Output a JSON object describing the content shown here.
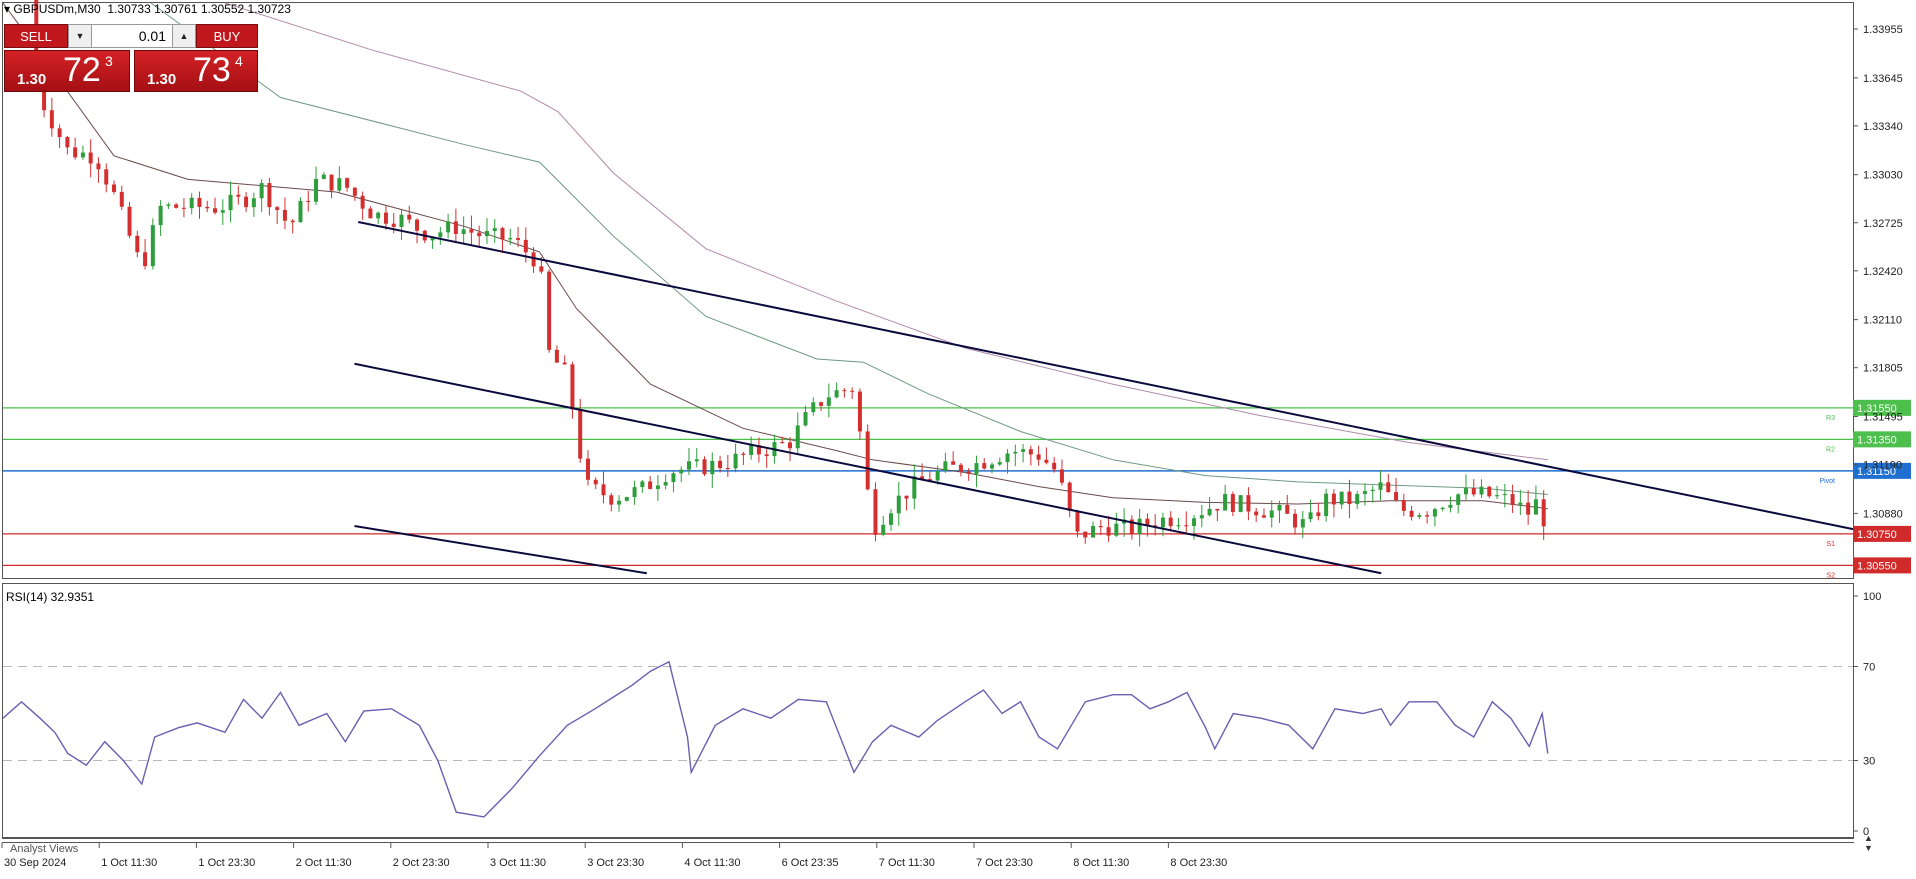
{
  "symbol_header": {
    "symbol": "GBPUSDm,M30",
    "ohlc": "1.30733 1.30761 1.30552 1.30723"
  },
  "trade_panel": {
    "sell_label": "SELL",
    "buy_label": "BUY",
    "lot": "0.01",
    "sell_quote": {
      "prefix": "1.30",
      "big": "72",
      "sup": "3"
    },
    "buy_quote": {
      "prefix": "1.30",
      "big": "73",
      "sup": "4"
    }
  },
  "rsi_header": "RSI(14) 32.9351",
  "analyst_views_label": "Analyst Views",
  "colors": {
    "candle_up": "#2e9e3c",
    "candle_down": "#d32f2f",
    "rsi_line": "#6a5fb0",
    "ma_fast": "#6b4a4a",
    "ma_mid": "#6f9a80",
    "ma_slow": "#b08aa8",
    "channel": "#0a0a3c",
    "resistance": "#4cbf4c",
    "pivot": "#1f6fd0",
    "support": "#d12a2a",
    "grid_dash": "#b8b8b8"
  },
  "chart_data": {
    "type": "candlestick",
    "price_axis_ticks": [
      "1.33955",
      "1.33645",
      "1.33340",
      "1.33030",
      "1.32725",
      "1.32420",
      "1.32110",
      "1.31805",
      "1.31495",
      "1.31190",
      "1.30880"
    ],
    "price_range": [
      1.3047,
      1.3412
    ],
    "time_axis_labels": [
      "30 Sep 2024",
      "1 Oct 11:30",
      "1 Oct 23:30",
      "2 Oct 11:30",
      "2 Oct 23:30",
      "3 Oct 11:30",
      "3 Oct 23:30",
      "4 Oct 11:30",
      "6 Oct 23:35",
      "7 Oct 11:30",
      "7 Oct 23:30",
      "8 Oct 11:30",
      "8 Oct 23:30"
    ],
    "close_path": [
      [
        0,
        1.3418
      ],
      [
        0.02,
        1.3352
      ],
      [
        0.035,
        1.3318
      ],
      [
        0.05,
        1.3315
      ],
      [
        0.06,
        1.329
      ],
      [
        0.075,
        1.3243
      ],
      [
        0.085,
        1.3282
      ],
      [
        0.1,
        1.3283
      ],
      [
        0.115,
        1.3282
      ],
      [
        0.13,
        1.3287
      ],
      [
        0.14,
        1.3295
      ],
      [
        0.155,
        1.327
      ],
      [
        0.17,
        1.33
      ],
      [
        0.185,
        1.3296
      ],
      [
        0.2,
        1.3278
      ],
      [
        0.215,
        1.3275
      ],
      [
        0.23,
        1.3265
      ],
      [
        0.245,
        1.327
      ],
      [
        0.26,
        1.3264
      ],
      [
        0.275,
        1.3262
      ],
      [
        0.29,
        1.3247
      ],
      [
        0.295,
        1.319
      ],
      [
        0.305,
        1.3175
      ],
      [
        0.315,
        1.3105
      ],
      [
        0.33,
        1.3098
      ],
      [
        0.345,
        1.3103
      ],
      [
        0.36,
        1.3115
      ],
      [
        0.375,
        1.3117
      ],
      [
        0.39,
        1.312
      ],
      [
        0.41,
        1.3128
      ],
      [
        0.425,
        1.3133
      ],
      [
        0.435,
        1.315
      ],
      [
        0.445,
        1.3163
      ],
      [
        0.46,
        1.3168
      ],
      [
        0.47,
        1.3078
      ],
      [
        0.48,
        1.3093
      ],
      [
        0.495,
        1.3108
      ],
      [
        0.51,
        1.3116
      ],
      [
        0.525,
        1.3119
      ],
      [
        0.545,
        1.3128
      ],
      [
        0.56,
        1.3125
      ],
      [
        0.57,
        1.3114
      ],
      [
        0.58,
        1.3073
      ],
      [
        0.595,
        1.308
      ],
      [
        0.61,
        1.3078
      ],
      [
        0.625,
        1.3084
      ],
      [
        0.64,
        1.3086
      ],
      [
        0.66,
        1.3096
      ],
      [
        0.675,
        1.3092
      ],
      [
        0.69,
        1.3088
      ],
      [
        0.705,
        1.308
      ],
      [
        0.715,
        1.3097
      ],
      [
        0.73,
        1.3096
      ],
      [
        0.745,
        1.3105
      ],
      [
        0.755,
        1.309
      ],
      [
        0.77,
        1.309
      ],
      [
        0.785,
        1.31
      ],
      [
        0.8,
        1.31
      ],
      [
        0.815,
        1.3096
      ],
      [
        0.825,
        1.3088
      ],
      [
        0.83,
        1.3097
      ],
      [
        0.835,
        1.3075
      ]
    ],
    "moving_averages": {
      "fast": [
        [
          0,
          1.3412
        ],
        [
          0.02,
          1.338
        ],
        [
          0.06,
          1.3315
        ],
        [
          0.1,
          1.33
        ],
        [
          0.18,
          1.3292
        ],
        [
          0.25,
          1.327
        ],
        [
          0.29,
          1.3254
        ],
        [
          0.31,
          1.3218
        ],
        [
          0.35,
          1.317
        ],
        [
          0.4,
          1.3142
        ],
        [
          0.45,
          1.3128
        ],
        [
          0.47,
          1.3122
        ],
        [
          0.52,
          1.3114
        ],
        [
          0.56,
          1.3105
        ],
        [
          0.6,
          1.3098
        ],
        [
          0.65,
          1.3095
        ],
        [
          0.7,
          1.3094
        ],
        [
          0.75,
          1.3096
        ],
        [
          0.8,
          1.3096
        ],
        [
          0.835,
          1.3091
        ]
      ],
      "mid": [
        [
          0.08,
          1.3412
        ],
        [
          0.15,
          1.3352
        ],
        [
          0.25,
          1.3322
        ],
        [
          0.29,
          1.3311
        ],
        [
          0.33,
          1.3264
        ],
        [
          0.38,
          1.3213
        ],
        [
          0.44,
          1.3186
        ],
        [
          0.465,
          1.3184
        ],
        [
          0.5,
          1.3164
        ],
        [
          0.55,
          1.314
        ],
        [
          0.6,
          1.3122
        ],
        [
          0.65,
          1.3112
        ],
        [
          0.7,
          1.3108
        ],
        [
          0.75,
          1.3106
        ],
        [
          0.8,
          1.3104
        ],
        [
          0.835,
          1.31
        ]
      ],
      "slow": [
        [
          0.12,
          1.3412
        ],
        [
          0.2,
          1.3382
        ],
        [
          0.28,
          1.3356
        ],
        [
          0.3,
          1.3343
        ],
        [
          0.33,
          1.3304
        ],
        [
          0.38,
          1.3256
        ],
        [
          0.45,
          1.3223
        ],
        [
          0.52,
          1.3193
        ],
        [
          0.6,
          1.317
        ],
        [
          0.68,
          1.315
        ],
        [
          0.76,
          1.3133
        ],
        [
          0.835,
          1.3122
        ]
      ]
    },
    "trendlines": [
      [
        [
          0.192,
          1.3273
        ],
        [
          1.0,
          1.3078
        ]
      ],
      [
        [
          0.19,
          1.3183
        ],
        [
          0.745,
          1.305
        ]
      ],
      [
        [
          0.19,
          1.308
        ],
        [
          0.348,
          1.305
        ]
      ]
    ],
    "levels": [
      {
        "label": "R3",
        "value": "1.31550",
        "kind": "resistance"
      },
      {
        "label": "R2",
        "value": "1.31350",
        "kind": "resistance"
      },
      {
        "label": "Pivot",
        "value": "1.31150",
        "kind": "pivot"
      },
      {
        "label": "S1",
        "value": "1.30750",
        "kind": "support"
      },
      {
        "label": "S2",
        "value": "1.30550",
        "kind": "support"
      }
    ],
    "rsi": {
      "period": 14,
      "current": 32.9351,
      "levels": [
        70,
        30
      ],
      "axis_ticks": [
        "100",
        "70",
        "30",
        "0"
      ],
      "series": [
        [
          0,
          48
        ],
        [
          0.01,
          55
        ],
        [
          0.02,
          48
        ],
        [
          0.028,
          42
        ],
        [
          0.035,
          33
        ],
        [
          0.045,
          28
        ],
        [
          0.055,
          38
        ],
        [
          0.065,
          30
        ],
        [
          0.075,
          20
        ],
        [
          0.082,
          40
        ],
        [
          0.095,
          44
        ],
        [
          0.105,
          46
        ],
        [
          0.12,
          42
        ],
        [
          0.13,
          56
        ],
        [
          0.14,
          48
        ],
        [
          0.15,
          59
        ],
        [
          0.16,
          45
        ],
        [
          0.175,
          50
        ],
        [
          0.185,
          38
        ],
        [
          0.195,
          51
        ],
        [
          0.21,
          52
        ],
        [
          0.225,
          45
        ],
        [
          0.235,
          30
        ],
        [
          0.245,
          8
        ],
        [
          0.26,
          6
        ],
        [
          0.275,
          18
        ],
        [
          0.29,
          32
        ],
        [
          0.305,
          45
        ],
        [
          0.32,
          52
        ],
        [
          0.33,
          57
        ],
        [
          0.34,
          62
        ],
        [
          0.35,
          68
        ],
        [
          0.36,
          72
        ],
        [
          0.37,
          40
        ],
        [
          0.372,
          25
        ],
        [
          0.385,
          45
        ],
        [
          0.4,
          52
        ],
        [
          0.415,
          48
        ],
        [
          0.43,
          56
        ],
        [
          0.445,
          55
        ],
        [
          0.455,
          35
        ],
        [
          0.46,
          25
        ],
        [
          0.47,
          38
        ],
        [
          0.48,
          45
        ],
        [
          0.495,
          40
        ],
        [
          0.505,
          47
        ],
        [
          0.52,
          55
        ],
        [
          0.53,
          60
        ],
        [
          0.54,
          50
        ],
        [
          0.55,
          55
        ],
        [
          0.56,
          40
        ],
        [
          0.57,
          35
        ],
        [
          0.585,
          55
        ],
        [
          0.6,
          58
        ],
        [
          0.61,
          58
        ],
        [
          0.62,
          52
        ],
        [
          0.63,
          55
        ],
        [
          0.64,
          59
        ],
        [
          0.65,
          44
        ],
        [
          0.655,
          35
        ],
        [
          0.665,
          50
        ],
        [
          0.68,
          48
        ],
        [
          0.695,
          45
        ],
        [
          0.708,
          35
        ],
        [
          0.72,
          52
        ],
        [
          0.735,
          50
        ],
        [
          0.745,
          52
        ],
        [
          0.75,
          45
        ],
        [
          0.76,
          55
        ],
        [
          0.775,
          55
        ],
        [
          0.785,
          45
        ],
        [
          0.795,
          40
        ],
        [
          0.805,
          55
        ],
        [
          0.815,
          48
        ],
        [
          0.825,
          36
        ],
        [
          0.832,
          50
        ],
        [
          0.835,
          33
        ]
      ]
    }
  }
}
